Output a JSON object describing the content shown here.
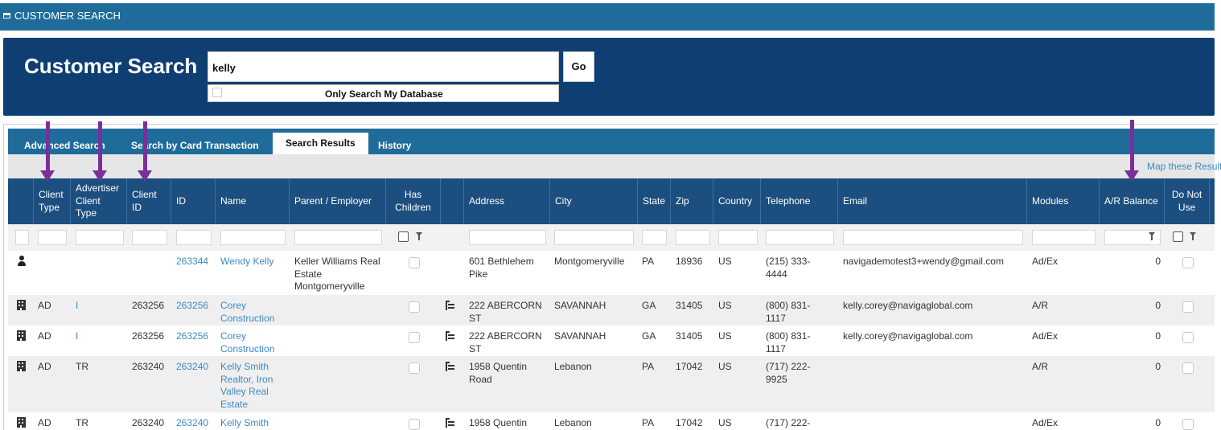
{
  "window": {
    "title": "CUSTOMER SEARCH"
  },
  "search": {
    "heading": "Customer Search",
    "query": "kelly",
    "go_label": "Go",
    "only_my_db_label": "Only Search My Database"
  },
  "tabs": [
    "Advanced Search",
    "Search by Card Transaction",
    "Search Results",
    "History"
  ],
  "active_tab": "Search Results",
  "map_link": "Map these Results",
  "columns": {
    "client_type": "Client Type",
    "adv_client_type": "Advertiser Client Type",
    "client_id": "Client ID",
    "id": "ID",
    "name": "Name",
    "parent": "Parent / Employer",
    "has_children": "Has Children",
    "address": "Address",
    "city": "City",
    "state": "State",
    "zip": "Zip",
    "country": "Country",
    "telephone": "Telephone",
    "email": "Email",
    "modules": "Modules",
    "ar_balance": "A/R Balance",
    "do_not_use": "Do Not Use"
  },
  "rows": [
    {
      "icon": "person-icon",
      "client_type": "",
      "adv_client_type": "",
      "client_id": "",
      "id": "263344",
      "name": "Wendy Kelly",
      "parent": "Keller Williams Real Estate Montgomeryville",
      "has_children": false,
      "hierarchy": false,
      "address": "601 Bethlehem Pike",
      "city": "Montgomeryville",
      "state": "PA",
      "zip": "18936",
      "country": "US",
      "telephone": "(215) 333-4444",
      "email": "navigademotest3+wendy@gmail.com",
      "modules": "Ad/Ex",
      "ar_balance": "0",
      "do_not_use": false
    },
    {
      "icon": "building-icon",
      "client_type": "AD",
      "adv_client_type": "I",
      "client_id": "263256",
      "id": "263256",
      "name": "Corey Construction",
      "parent": "",
      "has_children": false,
      "hierarchy": true,
      "address": "222 ABERCORN ST",
      "city": "SAVANNAH",
      "state": "GA",
      "zip": "31405",
      "country": "US",
      "telephone": "(800) 831-1117",
      "email": "kelly.corey@navigaglobal.com",
      "modules": "A/R",
      "ar_balance": "0",
      "do_not_use": false
    },
    {
      "icon": "building-icon",
      "client_type": "AD",
      "adv_client_type": "I",
      "client_id": "263256",
      "id": "263256",
      "name": "Corey Construction",
      "parent": "",
      "has_children": false,
      "hierarchy": true,
      "address": "222 ABERCORN ST",
      "city": "SAVANNAH",
      "state": "GA",
      "zip": "31405",
      "country": "US",
      "telephone": "(800) 831-1117",
      "email": "kelly.corey@navigaglobal.com",
      "modules": "Ad/Ex",
      "ar_balance": "0",
      "do_not_use": false
    },
    {
      "icon": "building-icon",
      "client_type": "AD",
      "adv_client_type": "TR",
      "client_id": "263240",
      "id": "263240",
      "name": "Kelly Smith Realtor, Iron Valley Real Estate",
      "parent": "",
      "has_children": false,
      "hierarchy": true,
      "address": "1958 Quentin Road",
      "city": "Lebanon",
      "state": "PA",
      "zip": "17042",
      "country": "US",
      "telephone": "(717) 222-9925",
      "email": "",
      "modules": "A/R",
      "ar_balance": "0",
      "do_not_use": false
    },
    {
      "icon": "building-icon",
      "client_type": "AD",
      "adv_client_type": "TR",
      "client_id": "263240",
      "id": "263240",
      "name": "Kelly Smith",
      "parent": "",
      "has_children": false,
      "hierarchy": true,
      "address": "1958 Quentin",
      "city": "Lebanon",
      "state": "PA",
      "zip": "17042",
      "country": "US",
      "telephone": "(717) 222-",
      "email": "",
      "modules": "Ad/Ex",
      "ar_balance": "0",
      "do_not_use": false
    }
  ],
  "colors": {
    "topbar": "#1f6c9b",
    "panel": "#0f3f72",
    "header": "#1c4f7f",
    "link": "#3d8ac6",
    "arrow": "#7a2f9b"
  }
}
